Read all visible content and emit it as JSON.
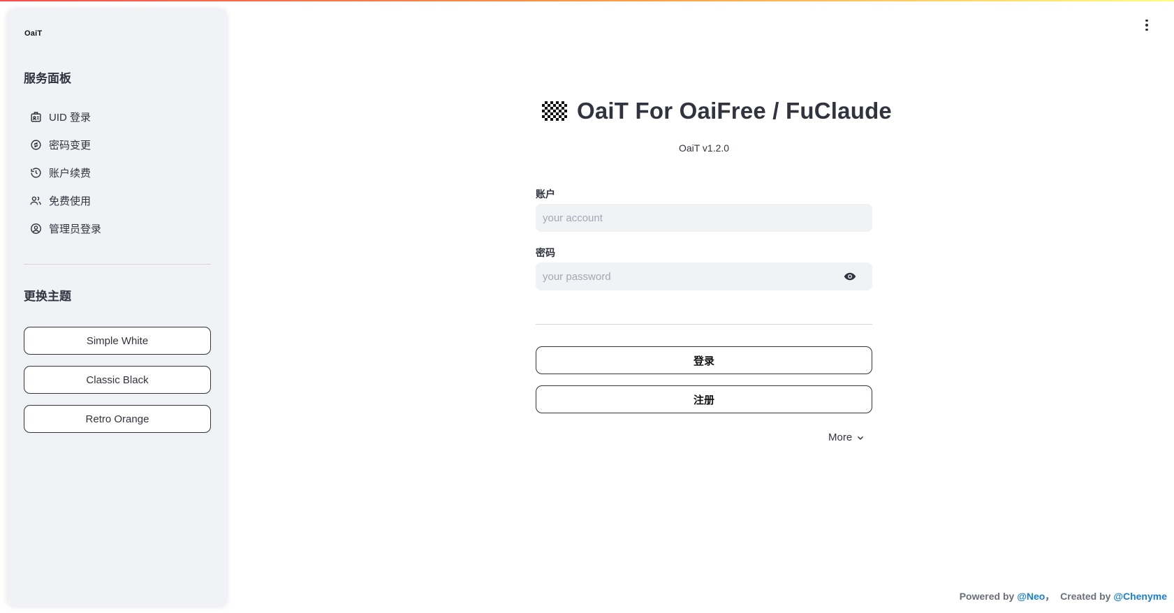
{
  "sidebar": {
    "logo": "OaiT",
    "service_title": "服务面板",
    "items": [
      {
        "label": "UID 登录"
      },
      {
        "label": "密码变更"
      },
      {
        "label": "账户续费"
      },
      {
        "label": "免费使用"
      },
      {
        "label": "管理员登录"
      }
    ],
    "theme_title": "更换主题",
    "themes": [
      {
        "label": "Simple White"
      },
      {
        "label": "Classic Black"
      },
      {
        "label": "Retro Orange"
      }
    ]
  },
  "main": {
    "title": "OaiT For OaiFree / FuClaude",
    "version": "OaiT v1.2.0",
    "account_label": "账户",
    "account_placeholder": "your account",
    "password_label": "密码",
    "password_placeholder": "your password",
    "login_button": "登录",
    "register_button": "注册",
    "more_label": "More"
  },
  "footer": {
    "powered_by": "Powered by",
    "neo": "@Neo",
    "separator": "，",
    "created_by": "Created by",
    "author": "@Chenyme"
  },
  "colors": {
    "accent": "#ff4b4b",
    "link": "#1c7ed6",
    "sidebar_bg": "#f0f2f6"
  }
}
